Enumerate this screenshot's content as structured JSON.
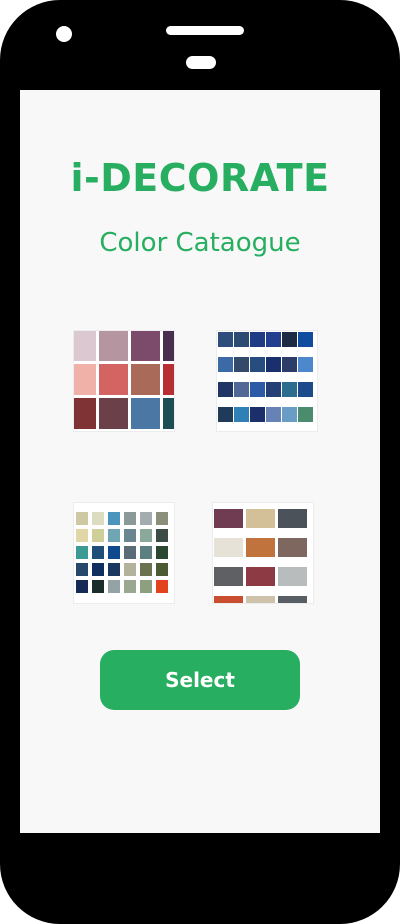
{
  "app": {
    "title": "i-DECORATE",
    "subtitle": "Color Cataogue"
  },
  "catalogues": [
    {
      "colors": [
        "#dcc8d0",
        "#b5959f",
        "#7c4a6b",
        "#4a3050",
        "#f0b1a8",
        "#d46461",
        "#a96a5a",
        "#b82f33",
        "#7f3335",
        "#6c4048",
        "#4a77a3",
        "#1d4d55"
      ]
    },
    {
      "colors": [
        "#2d4e7d",
        "#2d4a72",
        "#1e3b85",
        "#223f8f",
        "#1d2a43",
        "#0f4ca0",
        "#3c6aa6",
        "#344a6a",
        "#264d7e",
        "#1a2f6e",
        "#2b3d68",
        "#4c88cb",
        "#1e3566",
        "#516897",
        "#2c5aa6",
        "#233f75",
        "#2c6c8e",
        "#1c4a8a",
        "#203a5a",
        "#2f80b6",
        "#1c2f6a",
        "#6782b4",
        "#6a9dc5",
        "#4b8c6e"
      ]
    },
    {
      "colors": [
        "#cfc9a3",
        "#dbdcc0",
        "#4b94bd",
        "#8b9a98",
        "#a3acae",
        "#8a8f7b",
        "#e0d6a6",
        "#cfcf9a",
        "#70a6b4",
        "#6a8691",
        "#8aa99a",
        "#3a4c43",
        "#3b9a94",
        "#1f4f78",
        "#0f4a8e",
        "#5b6c78",
        "#5c8082",
        "#2b4631",
        "#26486a",
        "#0f2f5e",
        "#1a3960",
        "#b2b39a",
        "#6a7250",
        "#4c5b33",
        "#152a55",
        "#1a2d2a",
        "#94a4a6",
        "#9aa791",
        "#8d9f7f",
        "#e3431c"
      ]
    },
    {
      "colors": [
        "#6f3c51",
        "#d3bf98",
        "#4b5259",
        "#e6e2d7",
        "#c0733d",
        "#7d675f",
        "#5e6063",
        "#8d3a44",
        "#b8bcbd",
        "#c84e2f",
        "#cfc2aa",
        "#575f64"
      ]
    }
  ],
  "select_button": {
    "label": "Select"
  }
}
